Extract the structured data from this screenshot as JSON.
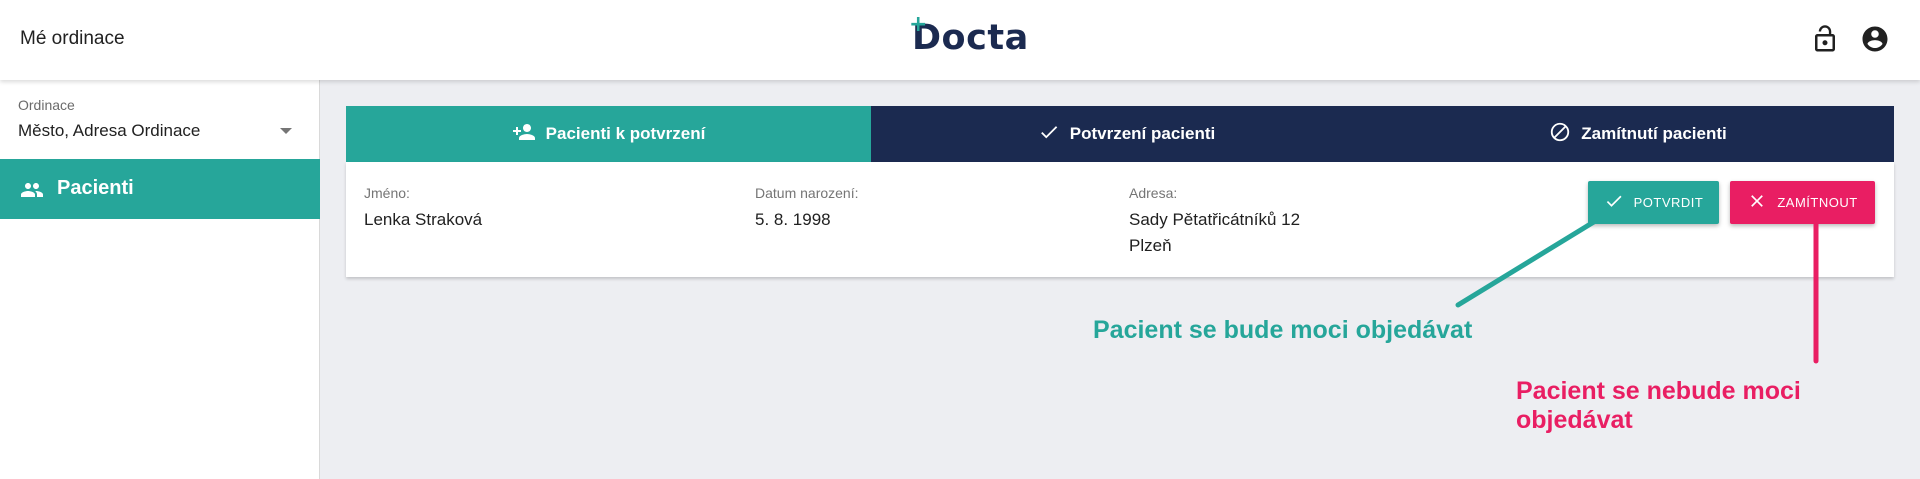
{
  "header": {
    "title": "Mé ordinace",
    "logo_text": "Docta",
    "icons": [
      "lock-open-icon",
      "account-circle-icon"
    ]
  },
  "sidebar": {
    "clinic_label": "Ordinace",
    "clinic_value": "Město, Adresa Ordinace",
    "items": [
      {
        "label": "Pacienti",
        "icon": "people-icon",
        "active": true
      }
    ]
  },
  "tabs": [
    {
      "label": "Pacienti k potvrzení",
      "icon": "person-add-icon",
      "active": true
    },
    {
      "label": "Potvrzení pacienti",
      "icon": "check-icon",
      "active": false
    },
    {
      "label": "Zamítnutí pacienti",
      "icon": "block-icon",
      "active": false
    }
  ],
  "patient": {
    "name_label": "Jméno:",
    "name": "Lenka Straková",
    "birth_label": "Datum narození:",
    "birth": "5. 8. 1998",
    "address_label": "Adresa:",
    "address_line1": "Sady Pětatřicátníků 12",
    "address_line2": "Plzeň"
  },
  "actions": {
    "confirm_label": "POTVRDIT",
    "reject_label": "ZAMÍTNOUT"
  },
  "annotations": {
    "confirm_note": "Pacient se bude moci objedávat",
    "reject_note": "Pacient se nebude moci objedávat"
  },
  "colors": {
    "accent": "#26a69a",
    "navy": "#1b2a50",
    "danger": "#e91e63",
    "background": "#edeef2"
  }
}
